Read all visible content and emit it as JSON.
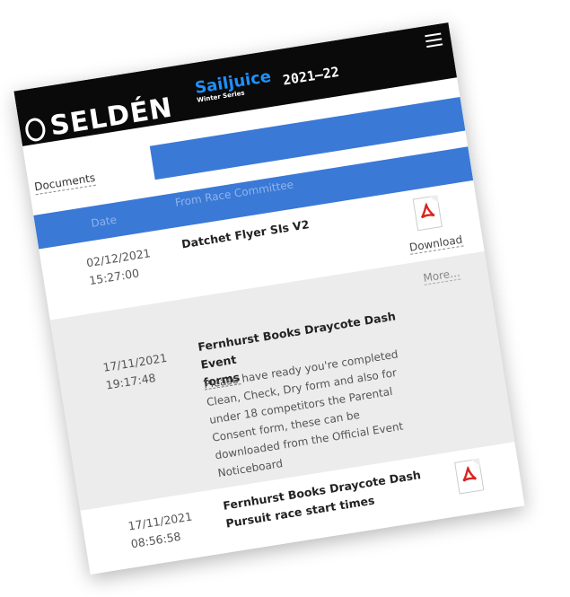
{
  "brand": {
    "logo_text": "SELDÉN",
    "series_name": "Sailjuice",
    "series_sub": "Winter Series",
    "season": "2021–22"
  },
  "section": {
    "label": "Documents"
  },
  "table": {
    "headers": {
      "date": "Date",
      "from": "From Race Committee"
    }
  },
  "rows": [
    {
      "date": "02/12/2021",
      "time": "15:27:00",
      "title": "Datchet Flyer SIs V2",
      "action": "Download"
    },
    {
      "date": "17/11/2021",
      "time": "19:17:48",
      "title_line1": "Fernhurst Books Draycote Dash Event",
      "title_line2": "forms",
      "more": "More...",
      "desc": [
        "Please have ready you're completed",
        "Clean, Check, Dry form and also for",
        "under 18 competitors the Parental",
        "Consent form, these can be",
        "downloaded from the Official Event",
        "Noticeboard"
      ]
    },
    {
      "date": "17/11/2021",
      "time": "08:56:58",
      "title_line1": "Fernhurst Books Draycote Dash",
      "title_line2": "Pursuit race start times"
    }
  ],
  "colors": {
    "header_bg": "#0a0a0a",
    "accent_blue": "#3a79d6",
    "sailjuice_blue": "#1e90ff",
    "pdf_red": "#d8261f"
  },
  "icons": {
    "menu": "hamburger-icon",
    "pdf": "pdf-icon",
    "logo": "selden-logo-icon"
  }
}
